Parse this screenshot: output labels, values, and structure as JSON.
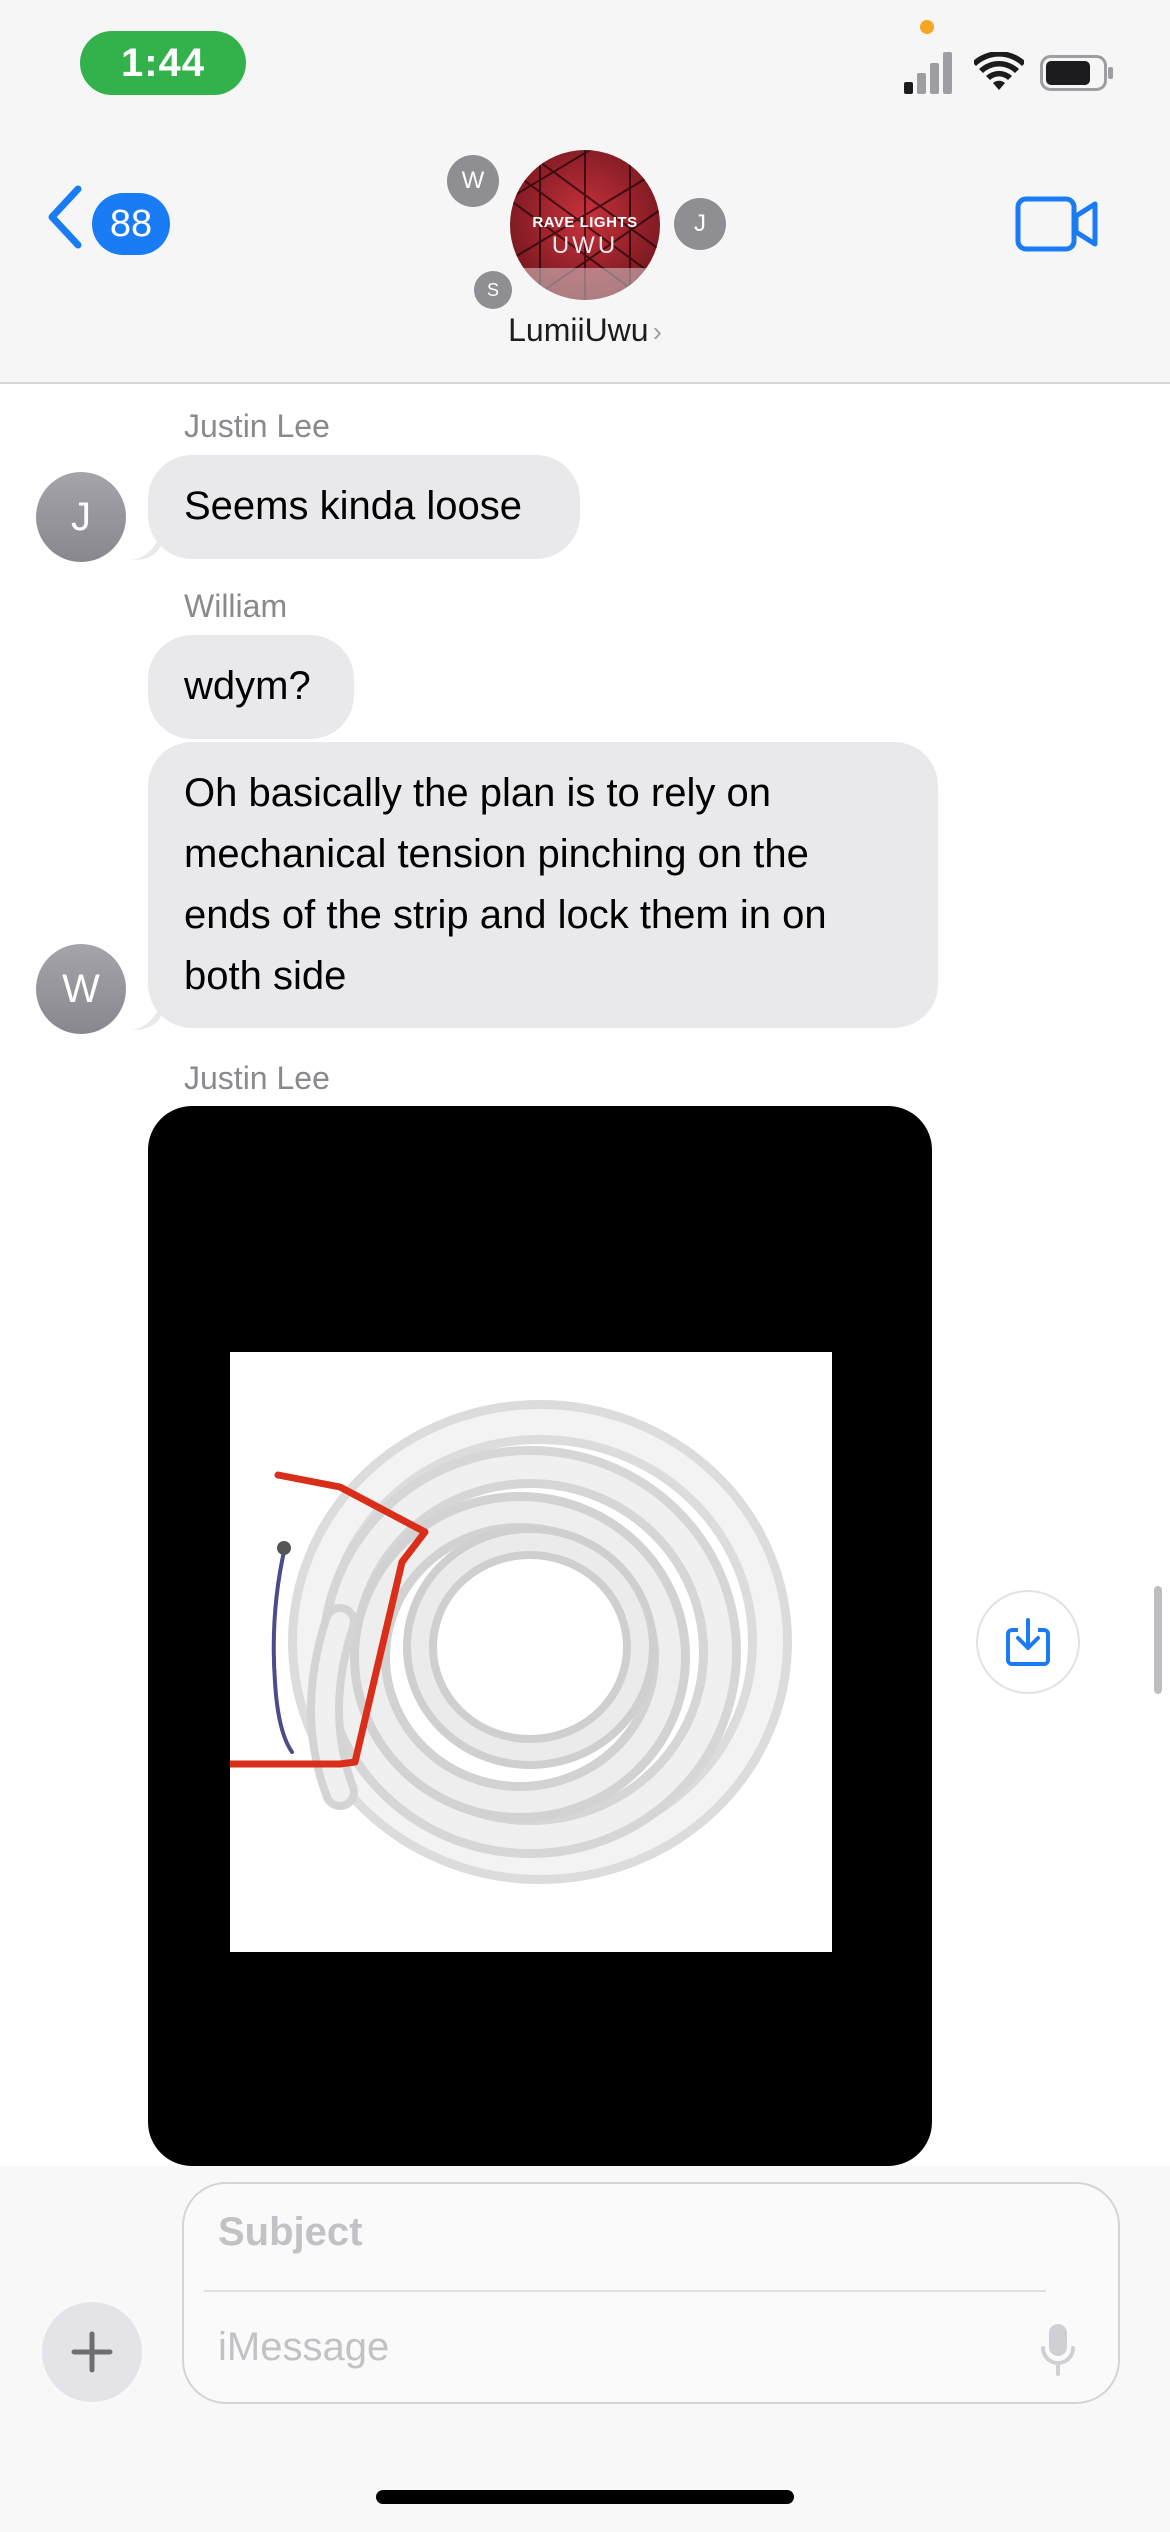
{
  "status_bar": {
    "time": "1:44"
  },
  "header": {
    "back_badge_count": "88",
    "group_name": "LumiiUwu",
    "group_avatar_line1": "RAVE LIGHTS",
    "group_avatar_line2": "UWU",
    "participant_initials": [
      "W",
      "J",
      "S"
    ]
  },
  "messages": [
    {
      "sender": "Justin Lee",
      "avatar": "J",
      "text": "Seems kinda loose"
    },
    {
      "sender": "William",
      "avatar": "W",
      "text": "wdym?"
    },
    {
      "sender": "William",
      "avatar": "W",
      "text": "Oh basically the plan is to rely on mechanical tension pinching on the ends of the strip and lock them in on both side"
    },
    {
      "sender": "Justin Lee",
      "avatar": "J",
      "type": "image"
    }
  ],
  "composer": {
    "subject_placeholder": "Subject",
    "message_placeholder": "iMessage"
  },
  "colors": {
    "accent": "#1a7cf5",
    "bubble_gray": "#e9e9eb",
    "time_pill": "#33b14a"
  },
  "icons": [
    "chevron-left-icon",
    "video-camera-icon",
    "signal-icon",
    "wifi-icon",
    "battery-icon",
    "save-download-icon",
    "plus-icon",
    "microphone-icon"
  ]
}
